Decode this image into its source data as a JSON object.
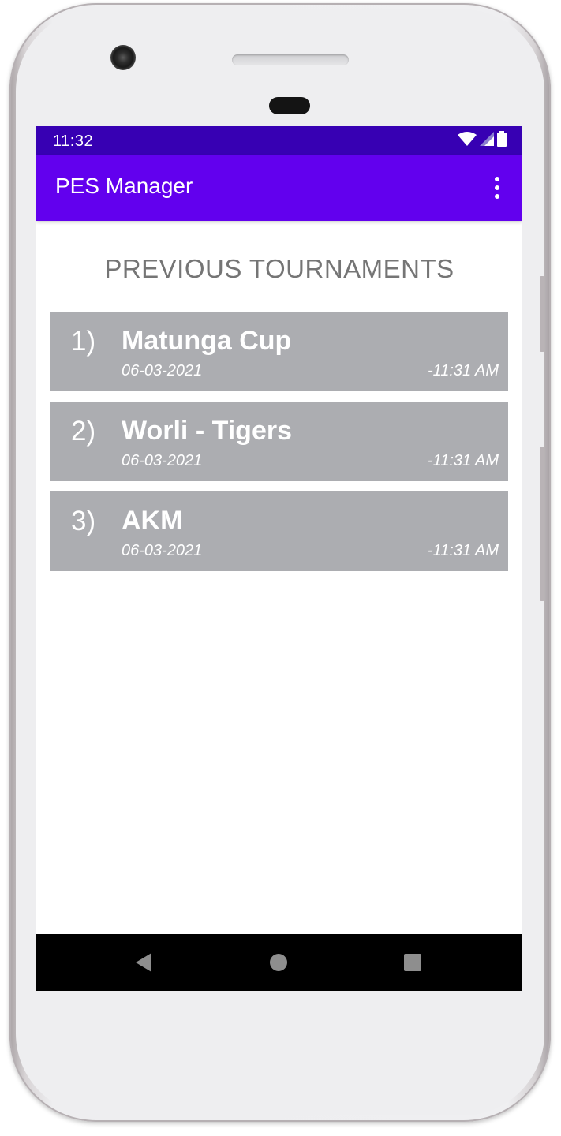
{
  "status_bar": {
    "time": "11:32",
    "icons": [
      "wifi-icon",
      "signal-icon",
      "battery-icon"
    ]
  },
  "app_bar": {
    "title": "PES Manager",
    "menu_icon": "more-vert-icon"
  },
  "page": {
    "heading": "PREVIOUS TOURNAMENTS"
  },
  "tournaments": [
    {
      "index": "1)",
      "name": "Matunga Cup",
      "date": "06-03-2021",
      "time": "-11:31 AM"
    },
    {
      "index": "2)",
      "name": "Worli - Tigers",
      "date": "06-03-2021",
      "time": "-11:31 AM"
    },
    {
      "index": "3)",
      "name": "AKM",
      "date": "06-03-2021",
      "time": "-11:31 AM"
    }
  ],
  "nav_bar": {
    "buttons": [
      "back-icon",
      "home-icon",
      "recents-icon"
    ]
  },
  "colors": {
    "status_bar": "#3700b3",
    "app_bar": "#6200ee",
    "card": "#acadb1",
    "heading": "#757575"
  }
}
